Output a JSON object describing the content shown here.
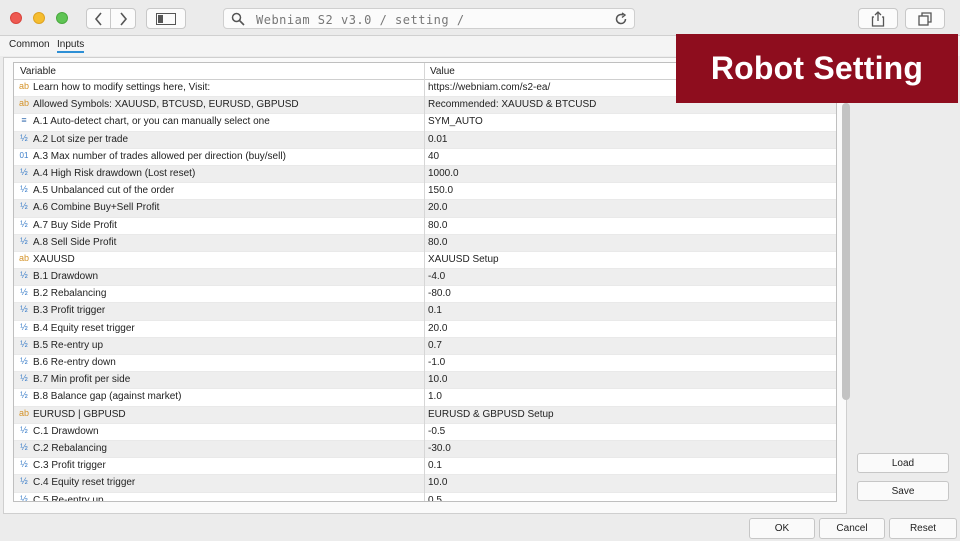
{
  "address_bar": {
    "text": "Webniam S2 v3.0 / setting /"
  },
  "tabs": [
    {
      "label": "Common"
    },
    {
      "label": "Inputs"
    }
  ],
  "grid": {
    "columns": [
      "Variable",
      "Value"
    ],
    "rows": [
      {
        "icon": "text-type-icon",
        "icon_glyph": "ab",
        "variable": "Learn how to modify settings here, Visit:",
        "value": "https://webniam.com/s2-ea/"
      },
      {
        "icon": "text-type-icon",
        "icon_glyph": "ab",
        "variable": "Allowed Symbols: XAUUSD, BTCUSD, EURUSD, GBPUSD",
        "value": "Recommended: XAUUSD & BTCUSD"
      },
      {
        "icon": "enum-type-icon",
        "icon_glyph": "≡",
        "variable": "A.1 Auto-detect chart, or you can manually select one",
        "value": "SYM_AUTO"
      },
      {
        "icon": "double-type-icon",
        "icon_glyph": "½",
        "variable": "A.2 Lot size per trade",
        "value": "0.01"
      },
      {
        "icon": "integer-type-icon",
        "icon_glyph": "01",
        "variable": "A.3 Max number of trades allowed per direction (buy/sell)",
        "value": "40"
      },
      {
        "icon": "double-type-icon",
        "icon_glyph": "½",
        "variable": "A.4 High Risk drawdown (Lost reset)",
        "value": "1000.0"
      },
      {
        "icon": "double-type-icon",
        "icon_glyph": "½",
        "variable": "A.5 Unbalanced cut of the order",
        "value": "150.0"
      },
      {
        "icon": "double-type-icon",
        "icon_glyph": "½",
        "variable": "A.6 Combine Buy+Sell Profit",
        "value": "20.0"
      },
      {
        "icon": "double-type-icon",
        "icon_glyph": "½",
        "variable": "A.7 Buy Side Profit",
        "value": "80.0"
      },
      {
        "icon": "double-type-icon",
        "icon_glyph": "½",
        "variable": "A.8 Sell Side Profit",
        "value": "80.0"
      },
      {
        "icon": "text-type-icon",
        "icon_glyph": "ab",
        "variable": "XAUUSD",
        "value": "XAUUSD Setup"
      },
      {
        "icon": "double-type-icon",
        "icon_glyph": "½",
        "variable": "B.1 Drawdown",
        "value": "-4.0"
      },
      {
        "icon": "double-type-icon",
        "icon_glyph": "½",
        "variable": "B.2 Rebalancing",
        "value": "-80.0"
      },
      {
        "icon": "double-type-icon",
        "icon_glyph": "½",
        "variable": "B.3 Profit trigger",
        "value": "0.1"
      },
      {
        "icon": "double-type-icon",
        "icon_glyph": "½",
        "variable": "B.4 Equity reset trigger",
        "value": "20.0"
      },
      {
        "icon": "double-type-icon",
        "icon_glyph": "½",
        "variable": "B.5 Re-entry up",
        "value": "0.7"
      },
      {
        "icon": "double-type-icon",
        "icon_glyph": "½",
        "variable": "B.6 Re-entry down",
        "value": "-1.0"
      },
      {
        "icon": "double-type-icon",
        "icon_glyph": "½",
        "variable": "B.7 Min profit per side",
        "value": "10.0"
      },
      {
        "icon": "double-type-icon",
        "icon_glyph": "½",
        "variable": "B.8 Balance gap (against market)",
        "value": "1.0"
      },
      {
        "icon": "text-type-icon",
        "icon_glyph": "ab",
        "variable": "EURUSD | GBPUSD",
        "value": "EURUSD & GBPUSD Setup"
      },
      {
        "icon": "double-type-icon",
        "icon_glyph": "½",
        "variable": "C.1 Drawdown",
        "value": "-0.5"
      },
      {
        "icon": "double-type-icon",
        "icon_glyph": "½",
        "variable": "C.2 Rebalancing",
        "value": "-30.0"
      },
      {
        "icon": "double-type-icon",
        "icon_glyph": "½",
        "variable": "C.3 Profit trigger",
        "value": "0.1"
      },
      {
        "icon": "double-type-icon",
        "icon_glyph": "½",
        "variable": "C.4 Equity reset trigger",
        "value": "10.0"
      },
      {
        "icon": "double-type-icon",
        "icon_glyph": "½",
        "variable": "C.5 Re-entry up",
        "value": "0.5"
      }
    ]
  },
  "side_buttons": {
    "load": "Load",
    "save": "Save"
  },
  "footer_buttons": {
    "ok": "OK",
    "cancel": "Cancel",
    "reset": "Reset"
  },
  "banner": {
    "text": "Robot Setting",
    "background": "#8e0d1e"
  },
  "colors": {
    "tab_underline": "#2d8fd5",
    "text_icon": "#d4932a",
    "number_icon": "#3b7ec9"
  }
}
